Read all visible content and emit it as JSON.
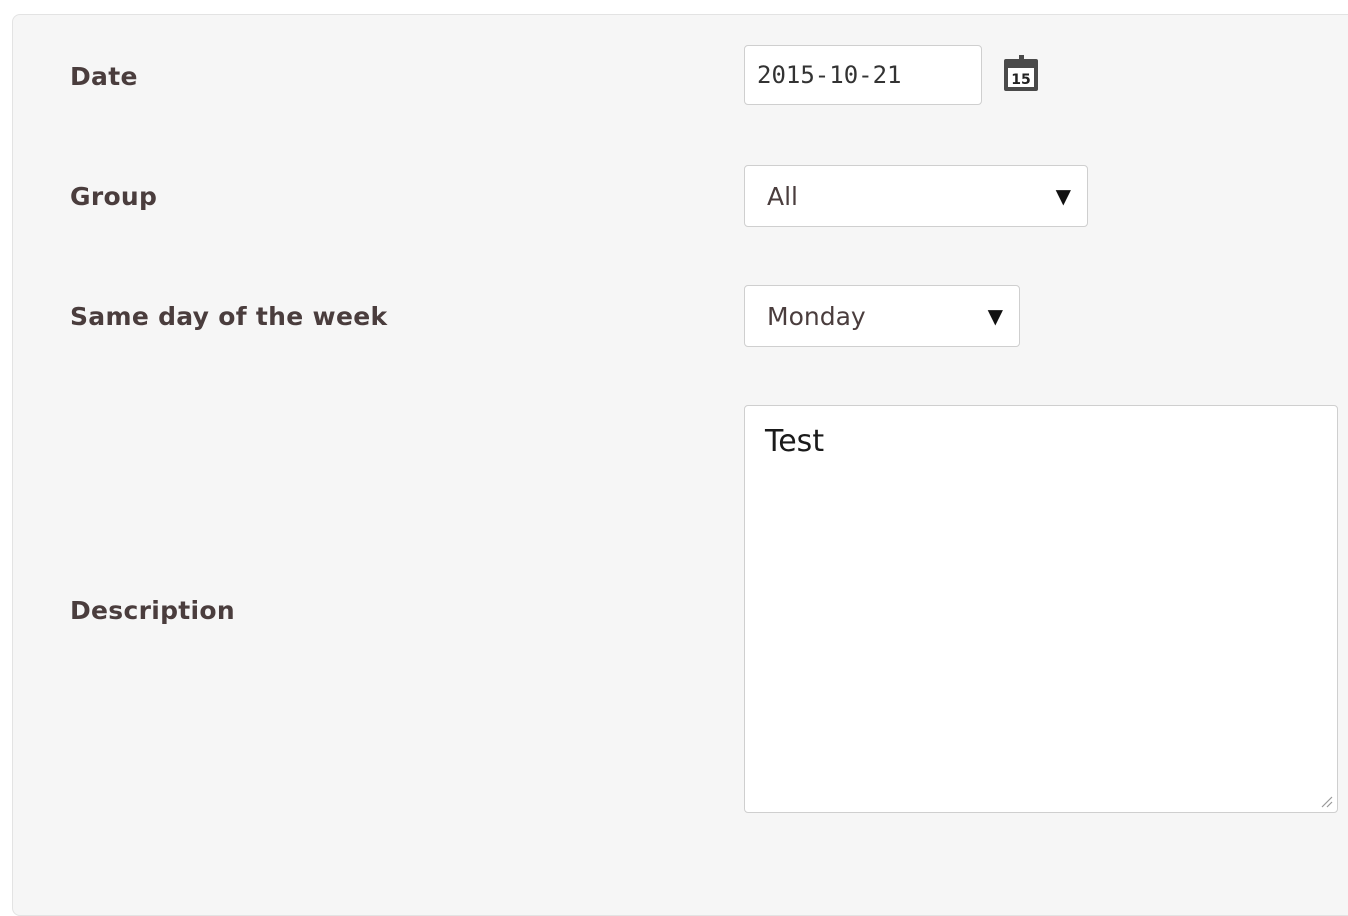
{
  "form": {
    "date": {
      "label": "Date",
      "value": "2015-10-21",
      "calendar_icon_text": "15"
    },
    "group": {
      "label": "Group",
      "selected": "All"
    },
    "same_day_of_week": {
      "label": "Same day of the week",
      "selected": "Monday"
    },
    "description": {
      "label": "Description",
      "value": "Test"
    }
  },
  "icons": {
    "calendar": "calendar-icon",
    "dropdown": "triangle-down",
    "resize": "resize-grip-icon"
  },
  "colors": {
    "panel_bg": "#f6f6f6",
    "label_text": "#4a3d3d",
    "field_border": "#cfcfcf"
  }
}
